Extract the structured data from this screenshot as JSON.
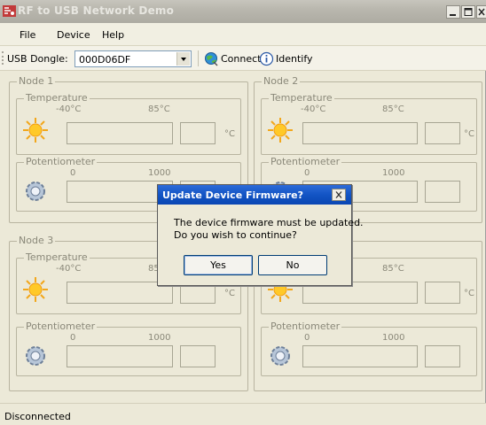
{
  "window": {
    "title": "RF to USB Network Demo"
  },
  "menu": {
    "items": [
      "File",
      "Device",
      "Help"
    ]
  },
  "toolbar": {
    "dongle_label": "USB Dongle:",
    "dongle_value": "000D06DF",
    "connect_label": "Connect",
    "identify_label": "Identify"
  },
  "nodes": [
    {
      "title": "Node 1",
      "temperature": {
        "label": "Temperature",
        "min": "-40°C",
        "max": "85°C",
        "unit": "°C"
      },
      "potentiometer": {
        "label": "Potentiometer",
        "min": "0",
        "max": "1000"
      }
    },
    {
      "title": "Node 2",
      "temperature": {
        "label": "Temperature",
        "min": "-40°C",
        "max": "85°C",
        "unit": "°C"
      },
      "potentiometer": {
        "label": "Potentiometer",
        "min": "0",
        "max": "1000"
      }
    },
    {
      "title": "Node 3",
      "temperature": {
        "label": "Temperature",
        "min": "-40°C",
        "max": "85",
        "unit": "°C"
      },
      "potentiometer": {
        "label": "Potentiometer",
        "min": "0",
        "max": "1000"
      }
    },
    {
      "title": "",
      "temperature": {
        "label": "",
        "min": "",
        "max": "85°C",
        "unit": "°C"
      },
      "potentiometer": {
        "label": "Potentiometer",
        "min": "0",
        "max": "1000"
      }
    }
  ],
  "status": {
    "text": "Disconnected"
  },
  "dialog": {
    "title": "Update Device Firmware?",
    "line1": "The device firmware must be updated.",
    "line2": "Do you wish to continue?",
    "yes_label": "Yes",
    "no_label": "No"
  },
  "colors": {
    "dialog_title": "#0a46b3",
    "window_bg": "#ece9d8"
  }
}
